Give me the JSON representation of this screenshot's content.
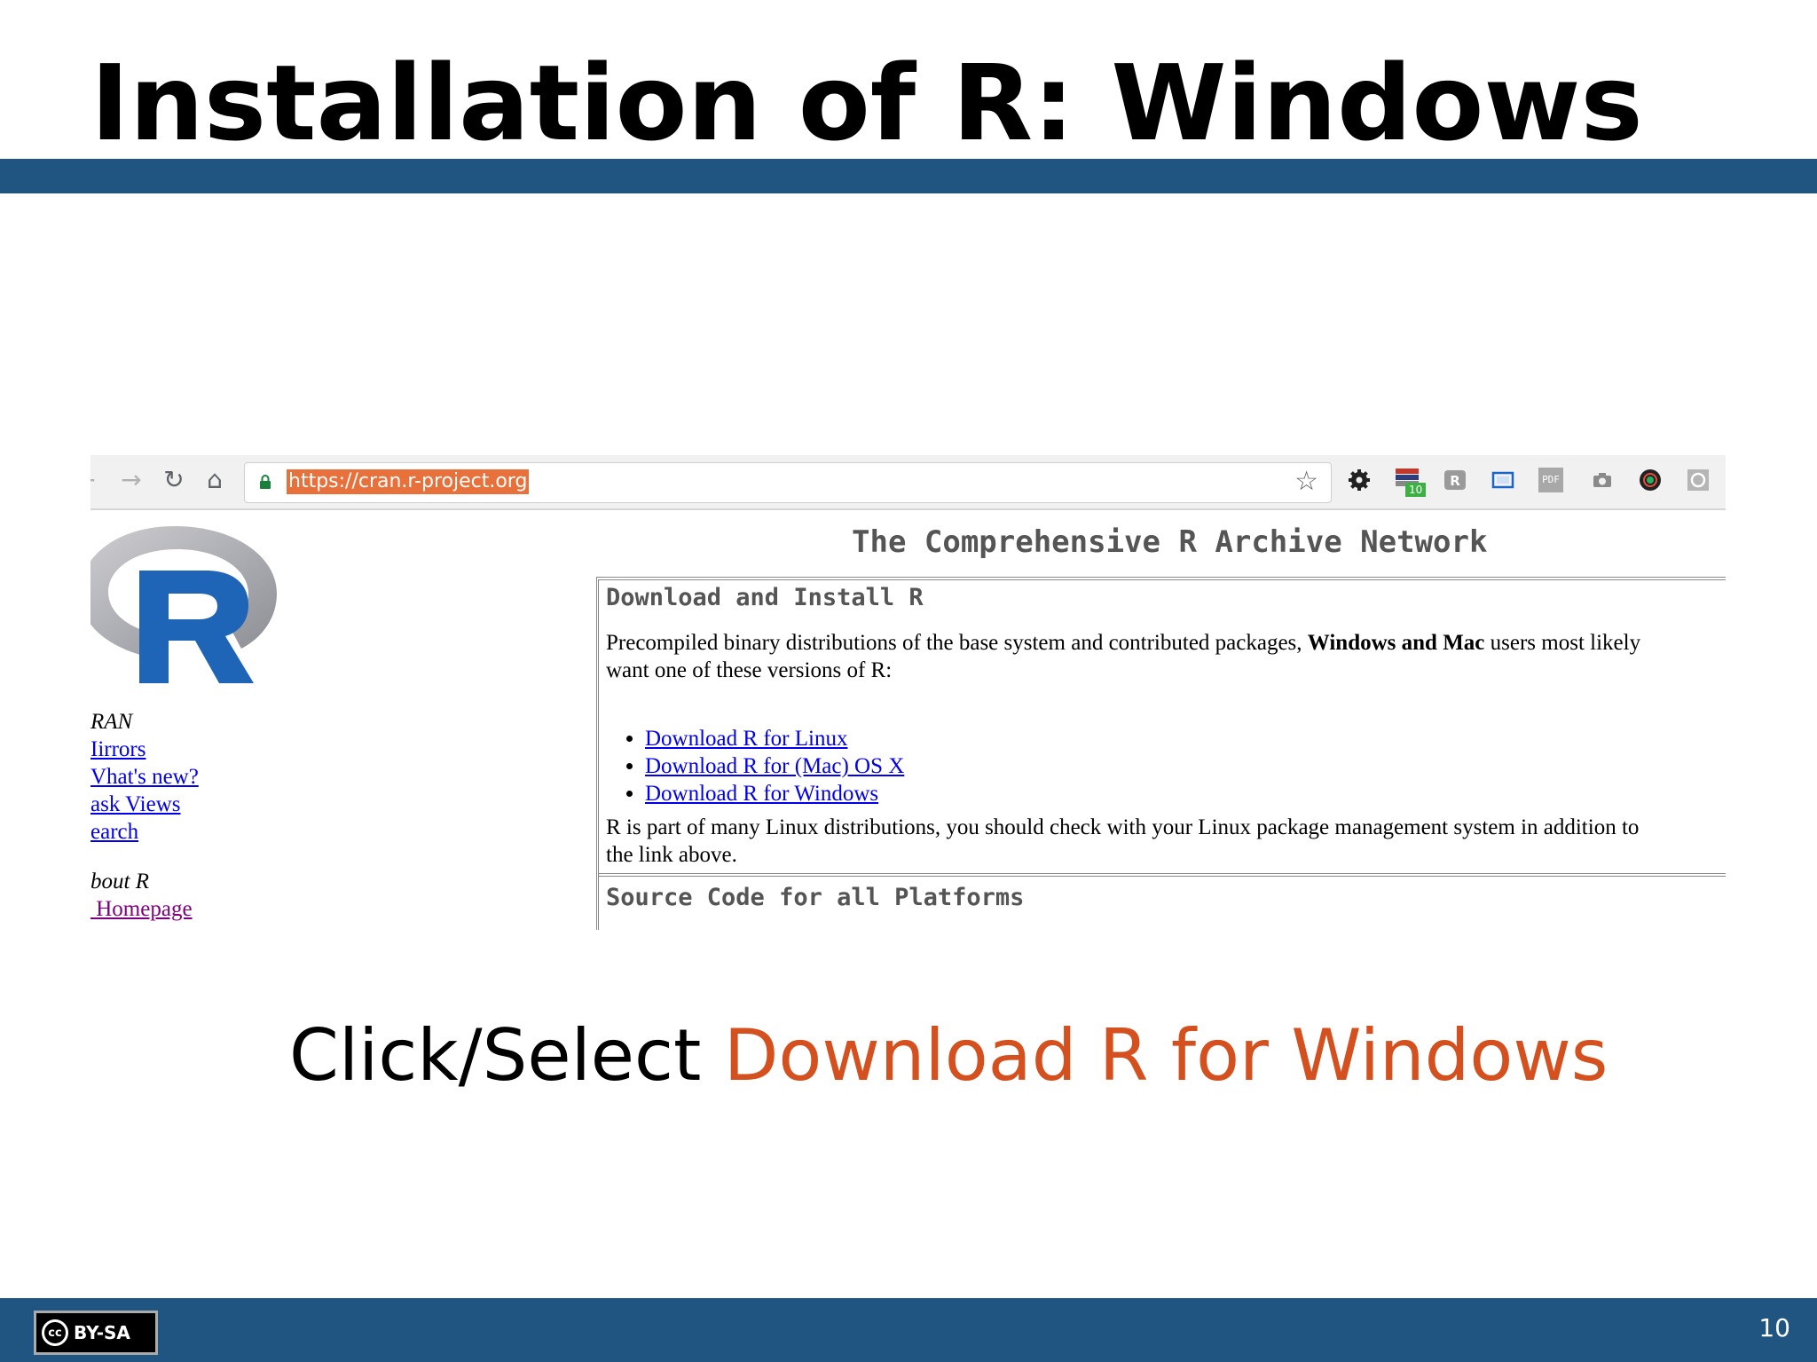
{
  "slide": {
    "title": "Installation of R: Windows",
    "caption_prefix": "Click/Select ",
    "caption_highlight": "Download R for Windows",
    "page_number": "10",
    "license_badge": "BY-SA",
    "license_cc": "cc"
  },
  "browser": {
    "url": "https://cran.r-project.org",
    "extension_badge": "10",
    "pdf_label": "PDF",
    "icons": [
      "back-arrow-icon",
      "forward-arrow-icon",
      "reload-icon",
      "home-icon",
      "lock-icon",
      "star-icon",
      "gear-icon",
      "tabs-counter-icon",
      "r-extension-icon",
      "screenshot-frame-icon",
      "pdf-icon",
      "camera-icon",
      "color-picker-icon",
      "generic-extension-icon"
    ]
  },
  "cran": {
    "header": "The Comprehensive R Archive Network",
    "section1_title": "Download and Install R",
    "intro_before": "Precompiled binary distributions of the base system and contributed packages, ",
    "intro_bold": "Windows and Mac",
    "intro_after": " users most likely",
    "intro_line2": "want one of these versions of R:",
    "links": [
      "Download R for Linux",
      "Download R for (Mac) OS X",
      "Download R for Windows"
    ],
    "note_line1": "R is part of many Linux distributions, you should check with your Linux package management system in addition to",
    "note_line2": "the link above.",
    "section2_title": "Source Code for all Platforms"
  },
  "sidebar": {
    "heading_cran": "RAN",
    "links": [
      "Iirrors",
      "Vhat's new?",
      "ask Views",
      "earch"
    ],
    "heading_about": "bout R",
    "homepage": " Homepage"
  },
  "colors": {
    "bar": "#1f5580",
    "accent": "#d4501e",
    "link": "#0000ee",
    "visited": "#800080",
    "url_highlight": "#e8703a"
  }
}
